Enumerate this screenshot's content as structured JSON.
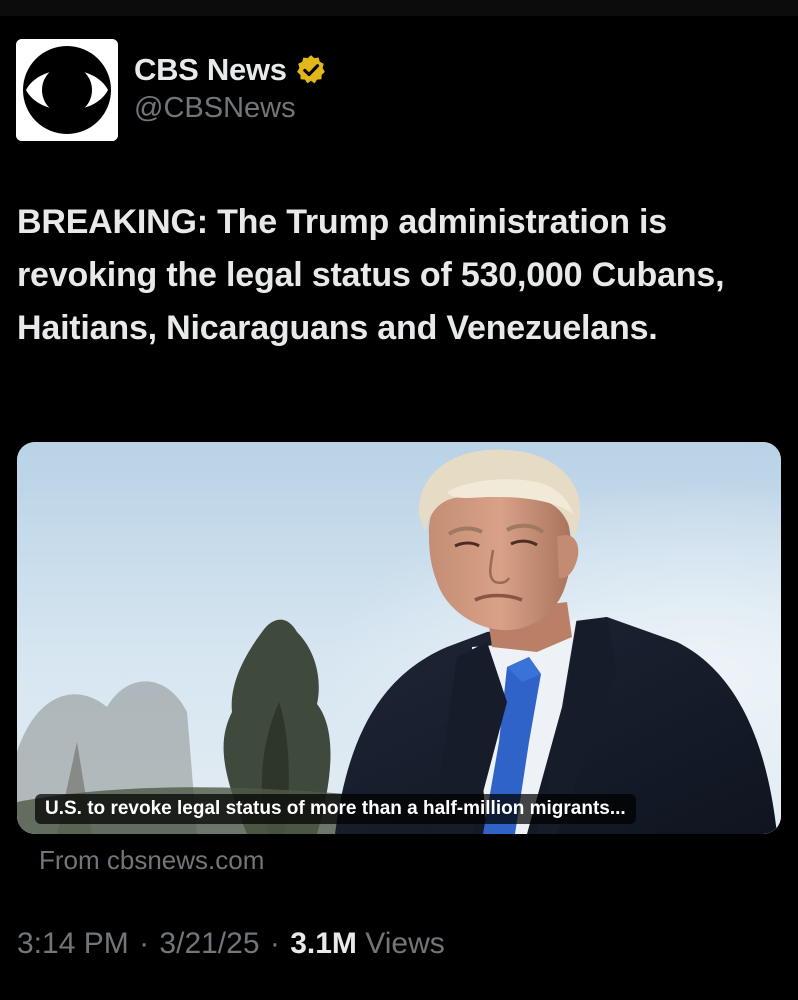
{
  "author": {
    "display_name": "CBS News",
    "handle": "@CBSNews",
    "avatar_icon": "cbs-eye-logo",
    "verified_icon": "gold-verified-badge-icon",
    "verified_color": "#e2b719"
  },
  "tweet": {
    "text": "BREAKING: The Trump administration is revoking the legal status of 530,000 Cubans, Haitians, Nicaraguans and Venezuelans."
  },
  "card": {
    "headline": "U.S. to revoke legal status of more than a half-million migrants...",
    "source": "From cbsnews.com"
  },
  "meta": {
    "time": "3:14 PM",
    "date": "3/21/25",
    "separator": "·",
    "views_count": "3.1M",
    "views_label": "Views"
  },
  "colors": {
    "background": "#000000",
    "primary_text": "#e7e9ea",
    "secondary_text": "#71767b"
  }
}
